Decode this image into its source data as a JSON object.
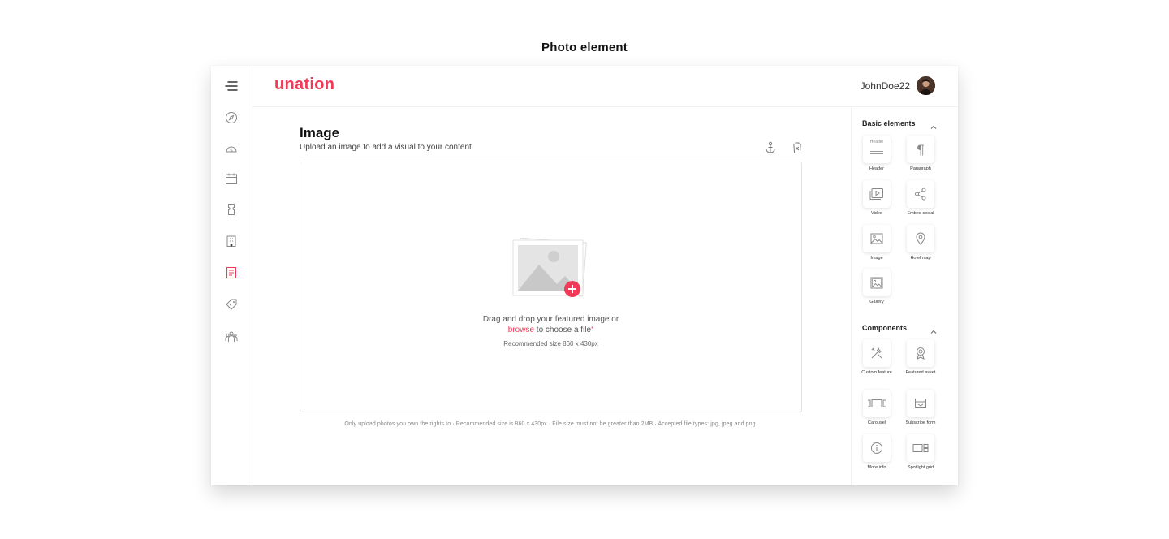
{
  "page": {
    "heading": "Photo element"
  },
  "topbar": {
    "logo": "unation",
    "username": "JohnDoe22"
  },
  "left_rail": {
    "icons": [
      "menu-icon",
      "compass-icon",
      "dashboard-gauge-icon",
      "calendar-icon",
      "ticket-icon",
      "building-icon",
      "article-icon",
      "tag-icon",
      "community-icon"
    ],
    "active_icon": "article-icon"
  },
  "editor": {
    "title": "Image",
    "subtitle": "Upload an image to add a visual to your content.",
    "drop_text_line1": "Drag and drop your featured image or",
    "browse_label": "browse",
    "drop_text_line2_rest": " to choose a file",
    "required_mark": "*",
    "recommended": "Recommended size  860 x 430px",
    "hint": "Only upload photos you own the rights to  ·  Recommended size is 860 x 430px ·  File size must not be greater than 2MB  ·  Accepted file types: jpg, jpeg and png"
  },
  "right_panel": {
    "basic_title": "Basic elements",
    "basic_items": [
      {
        "label": "Header",
        "icon": "header-icon",
        "glyph": "Header"
      },
      {
        "label": "Paragraph",
        "icon": "paragraph-icon",
        "glyph": "¶"
      },
      {
        "label": "Video",
        "icon": "video-icon"
      },
      {
        "label": "Embed social",
        "icon": "share-icon"
      },
      {
        "label": "Image",
        "icon": "image-icon"
      },
      {
        "label": "Hotel map",
        "icon": "map-pin-icon"
      },
      {
        "label": "Gallery",
        "icon": "gallery-icon"
      }
    ],
    "components_title": "Components",
    "component_items": [
      {
        "label": "Custom feature",
        "icon": "tools-icon"
      },
      {
        "label": "Featured asset",
        "icon": "badge-icon"
      },
      {
        "label": "Carousel",
        "icon": "carousel-icon"
      },
      {
        "label": "Subscribe form",
        "icon": "subscribe-icon"
      },
      {
        "label": "More info",
        "icon": "info-icon"
      },
      {
        "label": "Spotlight grid",
        "icon": "spotlight-grid-icon"
      }
    ]
  },
  "colors": {
    "brand": "#ef3b57",
    "icon_gray": "#888888",
    "drop_border": "#e3e3e3"
  }
}
